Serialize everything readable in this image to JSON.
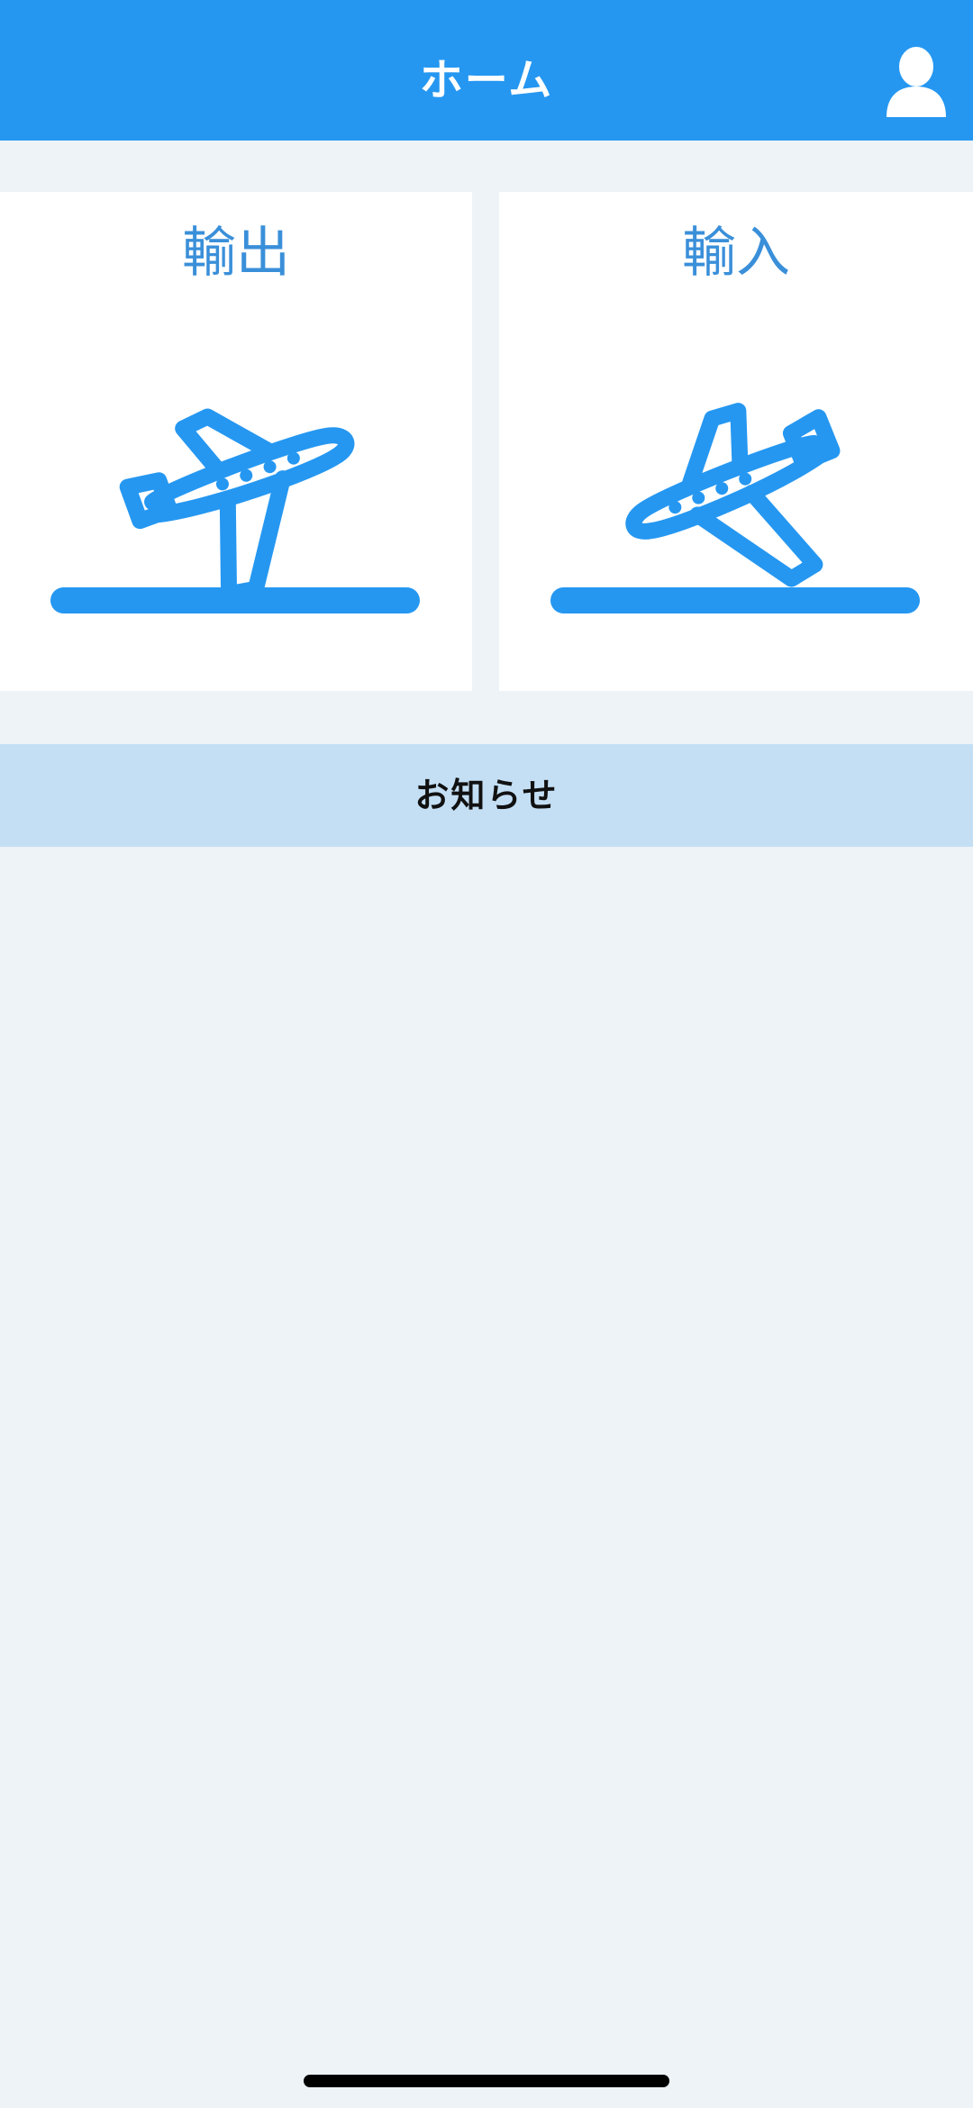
{
  "header": {
    "title": "ホーム",
    "profile_icon": "user-icon"
  },
  "cards": [
    {
      "label": "輸出",
      "icon": "airplane-takeoff-icon"
    },
    {
      "label": "輸入",
      "icon": "airplane-landing-icon"
    }
  ],
  "notice": {
    "label": "お知らせ"
  },
  "colors": {
    "primary": "#2597f1",
    "card_title": "#3a8fd9",
    "background": "#eef3f8",
    "notice_bar": "#c4dff4"
  }
}
